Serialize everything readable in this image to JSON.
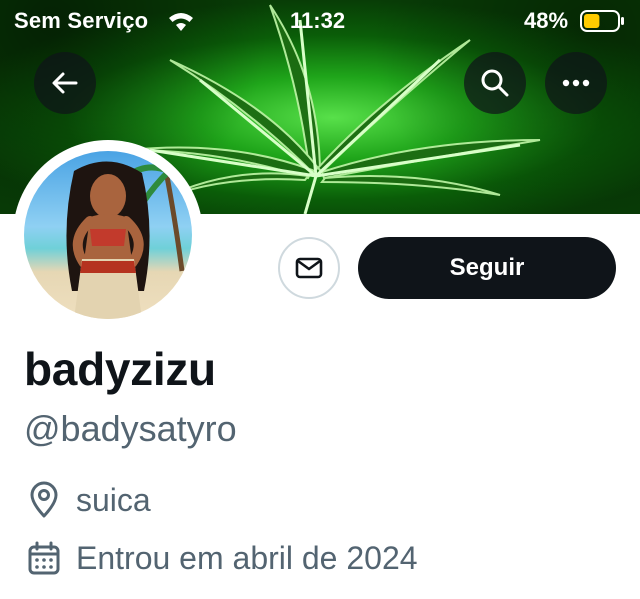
{
  "status_bar": {
    "carrier": "Sem Serviço",
    "time": "11:32",
    "battery_percent": "48%",
    "battery_level": 0.48,
    "wifi_icon": "wifi-icon",
    "battery_icon": "battery-icon"
  },
  "header": {
    "back_icon": "arrow-left-icon",
    "search_icon": "search-icon",
    "more_icon": "more-dots-icon"
  },
  "actions": {
    "message_icon": "envelope-icon",
    "follow_label": "Seguir"
  },
  "profile": {
    "display_name": "badyzizu",
    "handle": "@badysatyro",
    "location": "suica",
    "joined": "Entrou em abril de 2024",
    "location_icon": "location-pin-icon",
    "calendar_icon": "calendar-icon"
  },
  "colors": {
    "primary_text": "#0f1419",
    "secondary_text": "#536471",
    "follow_button_bg": "#0f1419",
    "banner_green": "#1fa51a",
    "battery_yellow": "#ffcc00"
  }
}
